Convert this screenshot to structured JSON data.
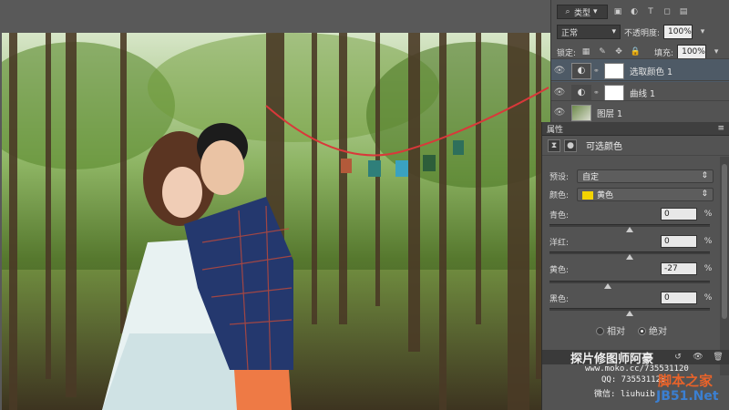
{
  "layers_panel": {
    "kind_label": "类型",
    "blend_mode": "正常",
    "opacity_label": "不透明度:",
    "opacity_value": "100%",
    "lock_label": "锁定:",
    "fill_label": "填充:",
    "fill_value": "100%",
    "layers": [
      {
        "name": "选取颜色 1",
        "type": "adjustment",
        "active": true
      },
      {
        "name": "曲线 1",
        "type": "adjustment",
        "active": false
      },
      {
        "name": "图层 1",
        "type": "image",
        "active": false
      }
    ]
  },
  "properties_panel": {
    "tab_label": "属性",
    "title": "可选颜色",
    "preset_label": "预设:",
    "preset_value": "自定",
    "colors_label": "颜色:",
    "colors_value": "黄色",
    "sliders": [
      {
        "label": "青色:",
        "value": "0",
        "unit": "%",
        "fraction": 0.5
      },
      {
        "label": "洋红:",
        "value": "0",
        "unit": "%",
        "fraction": 0.5
      },
      {
        "label": "黄色:",
        "value": "-27",
        "unit": "%",
        "fraction": 0.365
      },
      {
        "label": "黑色:",
        "value": "0",
        "unit": "%",
        "fraction": 0.5
      }
    ],
    "method_relative": "相对",
    "method_absolute": "绝对",
    "selected_method": "absolute"
  },
  "watermark": {
    "title": "探片修图师阿豪",
    "url": "www.moko.cc/735531120",
    "qq": "QQ: 735531120",
    "wechat": "微信:  liuhuib",
    "site_cn": "脚本之家",
    "site_en": "JB51.Net"
  },
  "colors": {
    "accent_yellow": "#f4d400",
    "panel_bg": "#535353"
  }
}
